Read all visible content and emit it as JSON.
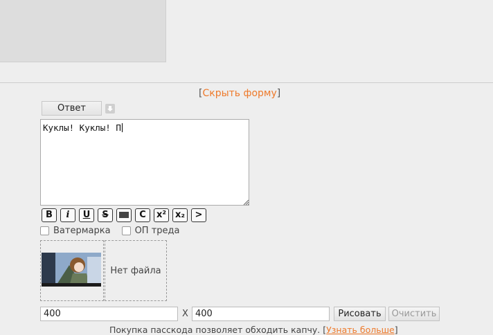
{
  "hide_form": {
    "link": "Скрыть форму",
    "open": "[",
    "close": "]"
  },
  "reply": {
    "button_label": "Ответ",
    "download_icon": "arrow-down-icon"
  },
  "message": {
    "value": "Куклы! Куклы! П"
  },
  "format_buttons": [
    "B",
    "i",
    "U",
    "S",
    "spoiler",
    "C",
    "x²",
    "x₂",
    ">"
  ],
  "checkboxes": {
    "watermark": "Ватермарка",
    "op": "ОП треда"
  },
  "files": {
    "empty_label": "Нет файла"
  },
  "drawing": {
    "width": "400",
    "height": "400",
    "separator": "X",
    "draw_label": "Рисовать",
    "clear_label": "Очистить"
  },
  "footer": {
    "text": "Покупка пасскода позволяет обходить капчу. ",
    "link": "Узнать больше",
    "open": "[",
    "close": "]"
  },
  "colors": {
    "accent": "#ee7a2b",
    "background": "#eeeeee"
  }
}
